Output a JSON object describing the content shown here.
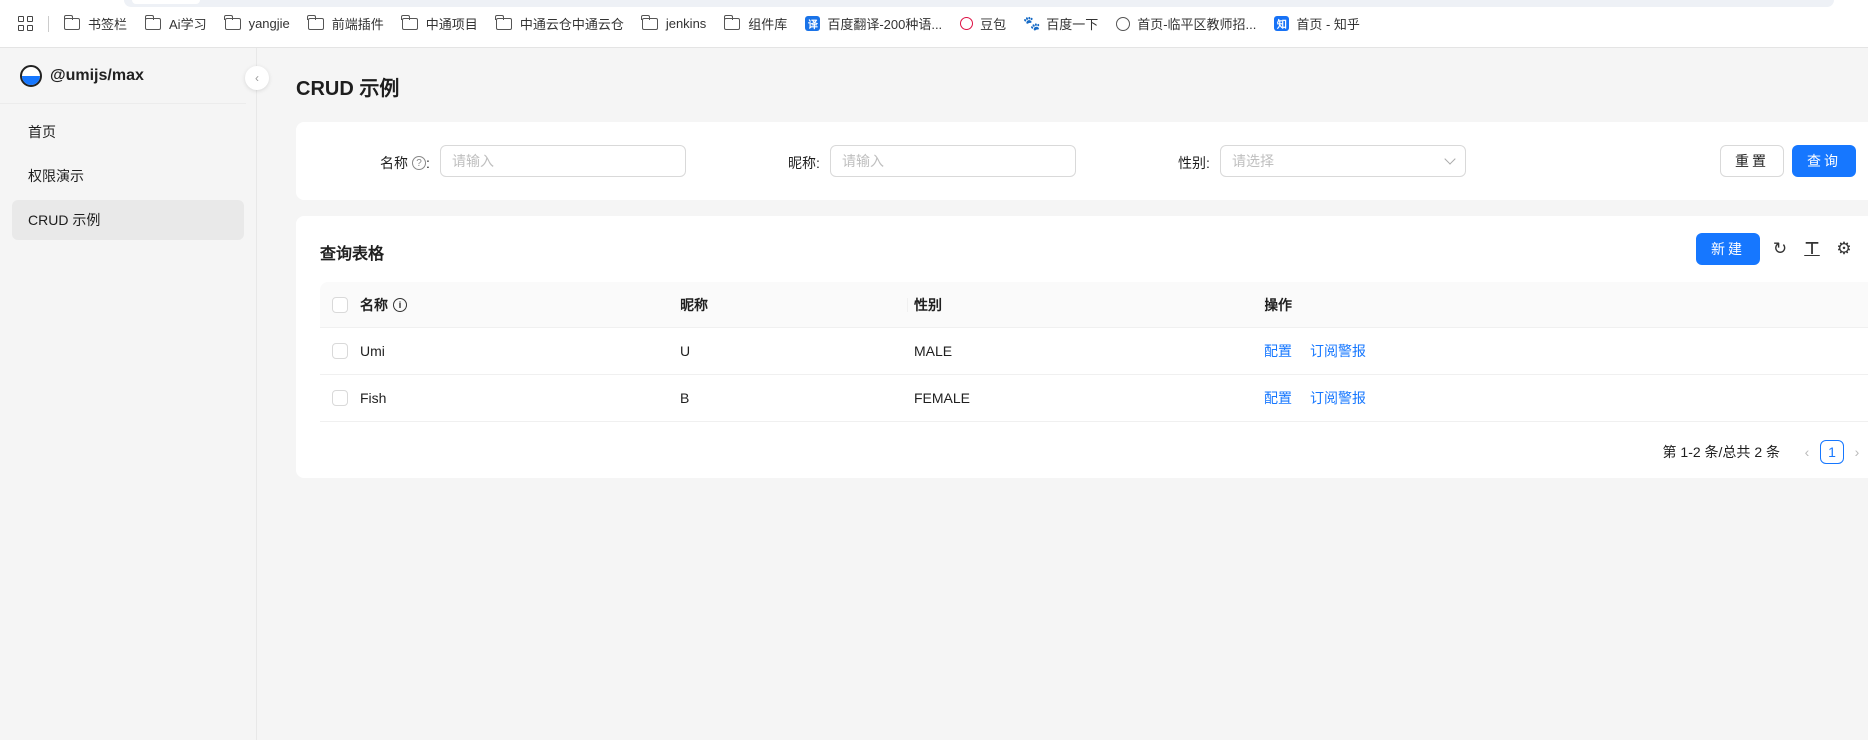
{
  "bookmarks": [
    {
      "label": "书签栏",
      "icon": "folder-icon"
    },
    {
      "label": "Ai学习",
      "icon": "folder-icon"
    },
    {
      "label": "yangjie",
      "icon": "folder-icon"
    },
    {
      "label": "前端插件",
      "icon": "folder-icon"
    },
    {
      "label": "中通项目",
      "icon": "folder-icon"
    },
    {
      "label": "中通云仓中通云仓",
      "icon": "folder-icon"
    },
    {
      "label": "jenkins",
      "icon": "folder-icon"
    },
    {
      "label": "组件库",
      "icon": "folder-icon"
    },
    {
      "label": "百度翻译-200种语...",
      "icon": "translate-icon",
      "glyph": "译"
    },
    {
      "label": "豆包",
      "icon": "doubao-icon"
    },
    {
      "label": "百度一下",
      "icon": "baidu-paw-icon",
      "glyph": "🐾"
    },
    {
      "label": "首页-临平区教师招...",
      "icon": "globe-icon"
    },
    {
      "label": "首页 - 知乎",
      "icon": "zhihu-icon",
      "glyph": "知"
    }
  ],
  "sidebar": {
    "logo_text": "@umijs/max",
    "collapse_glyph": "‹",
    "items": [
      {
        "label": "首页",
        "active": false
      },
      {
        "label": "权限演示",
        "active": false
      },
      {
        "label": "CRUD 示例",
        "active": true
      }
    ]
  },
  "page": {
    "title": "CRUD 示例"
  },
  "search": {
    "name_label": "名称",
    "name_help_glyph": "?",
    "name_colon": ":",
    "name_placeholder": "请输入",
    "nick_label": "昵称:",
    "nick_placeholder": "请输入",
    "gender_label": "性别:",
    "gender_placeholder": "请选择",
    "reset_label": "重置",
    "query_label": "查询"
  },
  "table": {
    "title": "查询表格",
    "new_label": "新建",
    "toolbar_glyphs": {
      "reload": "↻",
      "density": "⊤",
      "settings": "⚙"
    },
    "columns": {
      "name": "名称",
      "nick": "昵称",
      "gender": "性别",
      "ops": "操作"
    },
    "info_glyph": "i",
    "rows": [
      {
        "name": "Umi",
        "nick": "U",
        "gender": "MALE",
        "op1": "配置",
        "op2": "订阅警报"
      },
      {
        "name": "Fish",
        "nick": "B",
        "gender": "FEMALE",
        "op1": "配置",
        "op2": "订阅警报"
      }
    ]
  },
  "pagination": {
    "total_text": "第 1-2 条/总共 2 条",
    "current_page": "1",
    "prev_glyph": "‹",
    "next_glyph": "›"
  },
  "colors": {
    "primary": "#1677ff",
    "background": "#f5f5f5",
    "active_menu": "#e9e9e9"
  }
}
